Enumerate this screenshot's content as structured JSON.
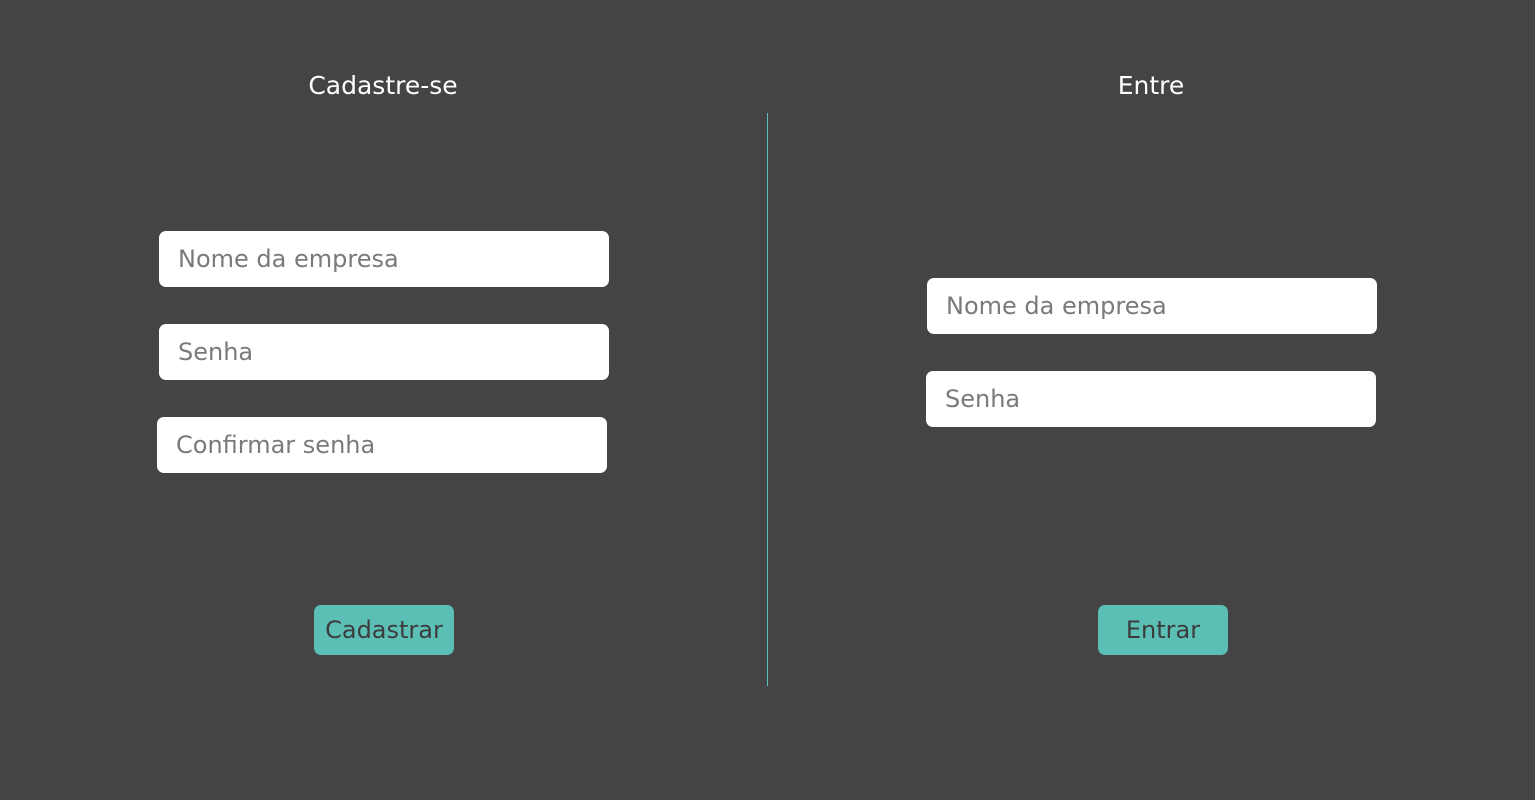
{
  "signup": {
    "title": "Cadastre-se",
    "company_placeholder": "Nome da empresa",
    "password_placeholder": "Senha",
    "confirm_placeholder": "Confirmar senha",
    "button_label": "Cadastrar"
  },
  "login": {
    "title": "Entre",
    "company_placeholder": "Nome da empresa",
    "password_placeholder": "Senha",
    "button_label": "Entrar"
  },
  "colors": {
    "background": "#444444",
    "accent": "#5bbfb5",
    "field": "#ffffff",
    "heading_text": "#ffffff",
    "placeholder_text": "#7a7a7a"
  }
}
